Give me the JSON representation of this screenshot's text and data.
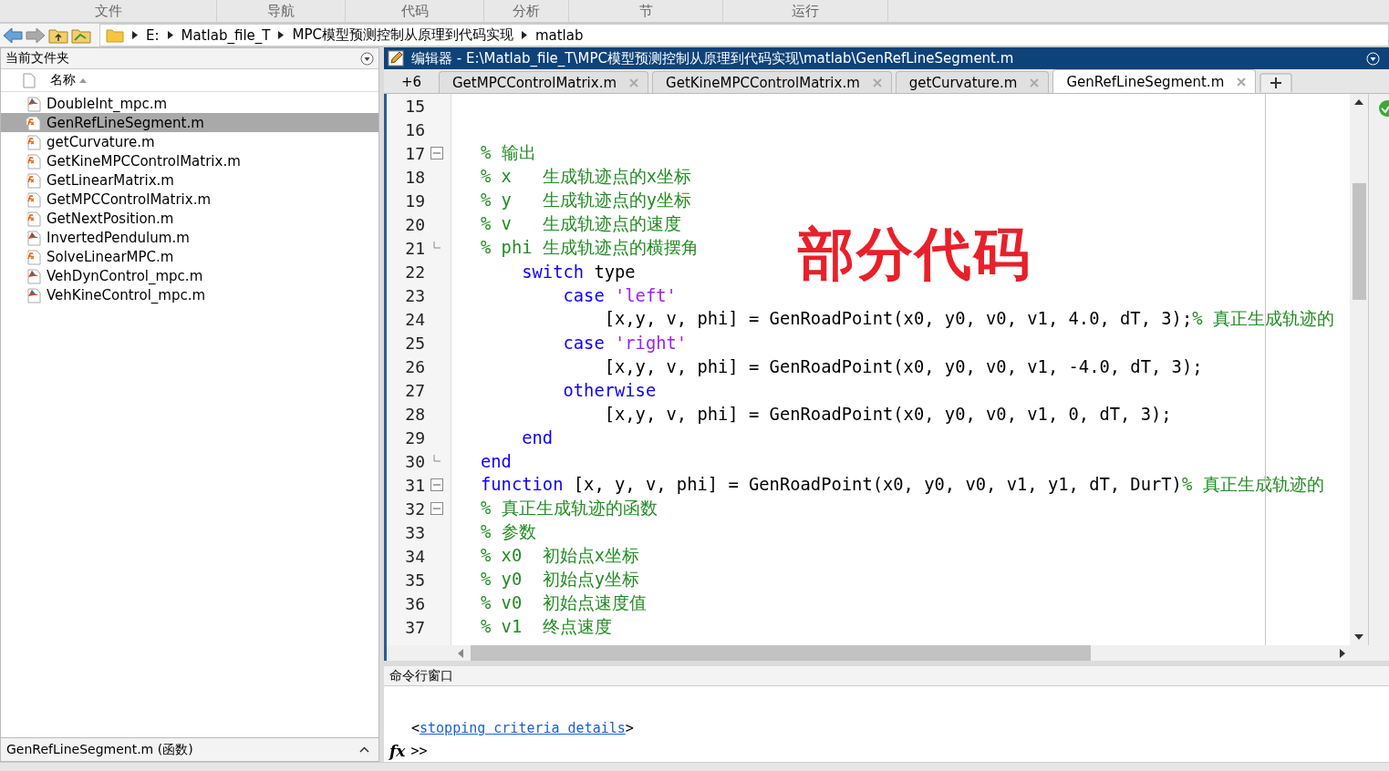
{
  "ribbon_tabs": [
    {
      "label": "文件"
    },
    {
      "label": "导航"
    },
    {
      "label": "代码"
    },
    {
      "label": "分析"
    },
    {
      "label": "节"
    },
    {
      "label": "运行"
    }
  ],
  "address_bar": {
    "segments": [
      "E:",
      "Matlab_file_T",
      "MPC模型预测控制从原理到代码实现",
      "matlab"
    ]
  },
  "file_panel": {
    "title": "当前文件夹",
    "column": "名称",
    "files": [
      {
        "name": "DoubleInt_mpc.m",
        "kind": "script",
        "selected": false
      },
      {
        "name": "GenRefLineSegment.m",
        "kind": "function",
        "selected": true
      },
      {
        "name": "getCurvature.m",
        "kind": "function",
        "selected": false
      },
      {
        "name": "GetKineMPCControlMatrix.m",
        "kind": "function",
        "selected": false
      },
      {
        "name": "GetLinearMatrix.m",
        "kind": "function",
        "selected": false
      },
      {
        "name": "GetMPCControlMatrix.m",
        "kind": "function",
        "selected": false
      },
      {
        "name": "GetNextPosition.m",
        "kind": "function",
        "selected": false
      },
      {
        "name": "InvertedPendulum.m",
        "kind": "script",
        "selected": false
      },
      {
        "name": "SolveLinearMPC.m",
        "kind": "function",
        "selected": false
      },
      {
        "name": "VehDynControl_mpc.m",
        "kind": "script",
        "selected": false
      },
      {
        "name": "VehKineControl_mpc.m",
        "kind": "script",
        "selected": false
      }
    ],
    "footer": "GenRefLineSegment.m  (函数)"
  },
  "editor": {
    "title": "编辑器 - E:\\Matlab_file_T\\MPC模型预测控制从原理到代码实现\\matlab\\GenRefLineSegment.m",
    "hidden_tabs": "+6",
    "tabs": [
      {
        "label": "GetMPCControlMatrix.m",
        "selected": false
      },
      {
        "label": "GetKineMPCControlMatrix.m",
        "selected": false
      },
      {
        "label": "getCurvature.m",
        "selected": false
      },
      {
        "label": "GenRefLineSegment.m",
        "selected": true
      }
    ],
    "lines": [
      {
        "number": "15"
      },
      {
        "number": "16"
      },
      {
        "number": "17",
        "fold_start": true,
        "tokens": [
          {
            "kind": "comment",
            "text": "% 输出"
          }
        ]
      },
      {
        "number": "18",
        "tokens": [
          {
            "kind": "comment",
            "text": "% x   生成轨迹点的x坐标"
          }
        ]
      },
      {
        "number": "19",
        "tokens": [
          {
            "kind": "comment",
            "text": "% y   生成轨迹点的y坐标"
          }
        ]
      },
      {
        "number": "20",
        "tokens": [
          {
            "kind": "comment",
            "text": "% v   生成轨迹点的速度"
          }
        ]
      },
      {
        "number": "21",
        "fold_end": true,
        "tokens": [
          {
            "kind": "comment",
            "text": "% phi 生成轨迹点的横摆角"
          }
        ]
      },
      {
        "number": "22",
        "tokens": [
          {
            "kind": "keyword",
            "text": "    switch"
          },
          {
            "kind": "plain",
            "text": " type"
          }
        ]
      },
      {
        "number": "23",
        "tokens": [
          {
            "kind": "keyword",
            "text": "        case"
          },
          {
            "kind": "string",
            "text": " 'left'"
          }
        ]
      },
      {
        "number": "24",
        "tokens": [
          {
            "kind": "plain",
            "text": "            [x,y, v, phi] = GenRoadPoint(x0, y0, v0, v1, 4.0, dT, 3);"
          },
          {
            "kind": "comment",
            "text": "% 真正生成轨迹的"
          }
        ]
      },
      {
        "number": "25",
        "tokens": [
          {
            "kind": "keyword",
            "text": "        case"
          },
          {
            "kind": "string",
            "text": " 'right'"
          }
        ]
      },
      {
        "number": "26",
        "tokens": [
          {
            "kind": "plain",
            "text": "            [x,y, v, phi] = GenRoadPoint(x0, y0, v0, v1, -4.0, dT, 3);"
          }
        ]
      },
      {
        "number": "27",
        "tokens": [
          {
            "kind": "keyword",
            "text": "        otherwise"
          }
        ]
      },
      {
        "number": "28",
        "tokens": [
          {
            "kind": "plain",
            "text": "            [x,y, v, phi] = GenRoadPoint(x0, y0, v0, v1, 0, dT, 3);"
          }
        ]
      },
      {
        "number": "29",
        "tokens": [
          {
            "kind": "keyword",
            "text": "    end"
          }
        ]
      },
      {
        "number": "30",
        "fold_end": true,
        "tokens": [
          {
            "kind": "keyword",
            "text": "end"
          }
        ]
      },
      {
        "number": "31",
        "fold_start": true,
        "tokens": [
          {
            "kind": "keyword",
            "text": "function"
          },
          {
            "kind": "plain",
            "text": " [x, y, v, phi] = GenRoadPoint(x0, y0, v0, v1, y1, dT, DurT)"
          },
          {
            "kind": "comment",
            "text": "% 真正生成轨迹的"
          }
        ]
      },
      {
        "number": "32",
        "fold_start": true,
        "tokens": [
          {
            "kind": "comment",
            "text": "% 真正生成轨迹的函数"
          }
        ]
      },
      {
        "number": "33",
        "tokens": [
          {
            "kind": "comment",
            "text": "% 参数"
          }
        ]
      },
      {
        "number": "34",
        "tokens": [
          {
            "kind": "comment",
            "text": "% x0  初始点x坐标"
          }
        ]
      },
      {
        "number": "35",
        "tokens": [
          {
            "kind": "comment",
            "text": "% y0  初始点y坐标"
          }
        ]
      },
      {
        "number": "36",
        "tokens": [
          {
            "kind": "comment",
            "text": "% v0  初始点速度值"
          }
        ]
      },
      {
        "number": "37",
        "tokens": [
          {
            "kind": "comment",
            "text": "% v1  终点速度"
          }
        ]
      }
    ]
  },
  "annotation": "部分代码",
  "command_window": {
    "title": "命令行窗口",
    "link_open": "<",
    "link": "stopping criteria details",
    "link_close": ">",
    "prompt_icon": "fx",
    "prompt": ">>"
  }
}
